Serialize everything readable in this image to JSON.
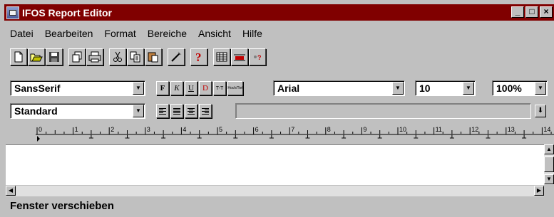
{
  "window": {
    "title": "IFOS Report Editor",
    "buttons": [
      "_",
      "□",
      "×"
    ]
  },
  "menu": [
    "Datei",
    "Bearbeiten",
    "Format",
    "Bereiche",
    "Ansicht",
    "Hilfe"
  ],
  "toolbar": {
    "icons": [
      "new-document-icon",
      "open-folder-icon",
      "save-icon",
      "copy-pages-icon",
      "print-icon",
      "cut-icon",
      "copy-icon",
      "paste-icon",
      "magic-wand-icon",
      "help-icon",
      "table-icon",
      "field-icon",
      "record-icon"
    ]
  },
  "format_row1": {
    "style_value": "SansSerif",
    "format_buttons": [
      "F",
      "K",
      "U",
      "D",
      "T-T",
      "Hoch/Tief"
    ],
    "font_value": "Arial",
    "size_value": "10",
    "zoom_value": "100%"
  },
  "format_row2": {
    "paragraph_value": "Standard",
    "align_buttons": [
      "align-left-icon",
      "align-justify-icon",
      "align-center-icon",
      "align-right-icon"
    ],
    "field_value": ""
  },
  "ruler": {
    "labels": [
      "0",
      "1",
      "2",
      "3",
      "4",
      "5",
      "6",
      "7",
      "8",
      "9",
      "10",
      "11",
      "12",
      "13",
      "14"
    ]
  },
  "status": {
    "text": "Fenster verschieben"
  }
}
